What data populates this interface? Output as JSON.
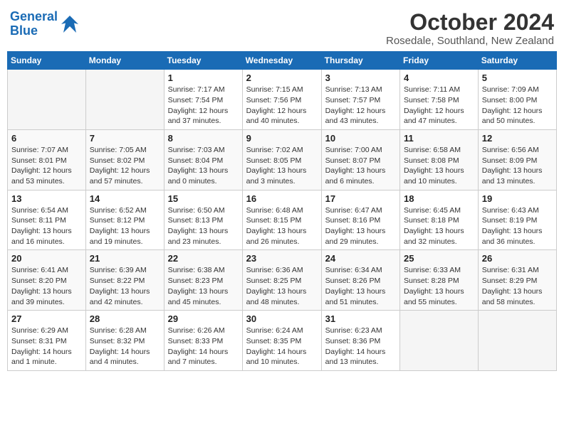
{
  "header": {
    "logo_line1": "General",
    "logo_line2": "Blue",
    "month": "October 2024",
    "location": "Rosedale, Southland, New Zealand"
  },
  "days_of_week": [
    "Sunday",
    "Monday",
    "Tuesday",
    "Wednesday",
    "Thursday",
    "Friday",
    "Saturday"
  ],
  "weeks": [
    [
      {
        "day": "",
        "content": ""
      },
      {
        "day": "",
        "content": ""
      },
      {
        "day": "1",
        "content": "Sunrise: 7:17 AM\nSunset: 7:54 PM\nDaylight: 12 hours and 37 minutes."
      },
      {
        "day": "2",
        "content": "Sunrise: 7:15 AM\nSunset: 7:56 PM\nDaylight: 12 hours and 40 minutes."
      },
      {
        "day": "3",
        "content": "Sunrise: 7:13 AM\nSunset: 7:57 PM\nDaylight: 12 hours and 43 minutes."
      },
      {
        "day": "4",
        "content": "Sunrise: 7:11 AM\nSunset: 7:58 PM\nDaylight: 12 hours and 47 minutes."
      },
      {
        "day": "5",
        "content": "Sunrise: 7:09 AM\nSunset: 8:00 PM\nDaylight: 12 hours and 50 minutes."
      }
    ],
    [
      {
        "day": "6",
        "content": "Sunrise: 7:07 AM\nSunset: 8:01 PM\nDaylight: 12 hours and 53 minutes."
      },
      {
        "day": "7",
        "content": "Sunrise: 7:05 AM\nSunset: 8:02 PM\nDaylight: 12 hours and 57 minutes."
      },
      {
        "day": "8",
        "content": "Sunrise: 7:03 AM\nSunset: 8:04 PM\nDaylight: 13 hours and 0 minutes."
      },
      {
        "day": "9",
        "content": "Sunrise: 7:02 AM\nSunset: 8:05 PM\nDaylight: 13 hours and 3 minutes."
      },
      {
        "day": "10",
        "content": "Sunrise: 7:00 AM\nSunset: 8:07 PM\nDaylight: 13 hours and 6 minutes."
      },
      {
        "day": "11",
        "content": "Sunrise: 6:58 AM\nSunset: 8:08 PM\nDaylight: 13 hours and 10 minutes."
      },
      {
        "day": "12",
        "content": "Sunrise: 6:56 AM\nSunset: 8:09 PM\nDaylight: 13 hours and 13 minutes."
      }
    ],
    [
      {
        "day": "13",
        "content": "Sunrise: 6:54 AM\nSunset: 8:11 PM\nDaylight: 13 hours and 16 minutes."
      },
      {
        "day": "14",
        "content": "Sunrise: 6:52 AM\nSunset: 8:12 PM\nDaylight: 13 hours and 19 minutes."
      },
      {
        "day": "15",
        "content": "Sunrise: 6:50 AM\nSunset: 8:13 PM\nDaylight: 13 hours and 23 minutes."
      },
      {
        "day": "16",
        "content": "Sunrise: 6:48 AM\nSunset: 8:15 PM\nDaylight: 13 hours and 26 minutes."
      },
      {
        "day": "17",
        "content": "Sunrise: 6:47 AM\nSunset: 8:16 PM\nDaylight: 13 hours and 29 minutes."
      },
      {
        "day": "18",
        "content": "Sunrise: 6:45 AM\nSunset: 8:18 PM\nDaylight: 13 hours and 32 minutes."
      },
      {
        "day": "19",
        "content": "Sunrise: 6:43 AM\nSunset: 8:19 PM\nDaylight: 13 hours and 36 minutes."
      }
    ],
    [
      {
        "day": "20",
        "content": "Sunrise: 6:41 AM\nSunset: 8:20 PM\nDaylight: 13 hours and 39 minutes."
      },
      {
        "day": "21",
        "content": "Sunrise: 6:39 AM\nSunset: 8:22 PM\nDaylight: 13 hours and 42 minutes."
      },
      {
        "day": "22",
        "content": "Sunrise: 6:38 AM\nSunset: 8:23 PM\nDaylight: 13 hours and 45 minutes."
      },
      {
        "day": "23",
        "content": "Sunrise: 6:36 AM\nSunset: 8:25 PM\nDaylight: 13 hours and 48 minutes."
      },
      {
        "day": "24",
        "content": "Sunrise: 6:34 AM\nSunset: 8:26 PM\nDaylight: 13 hours and 51 minutes."
      },
      {
        "day": "25",
        "content": "Sunrise: 6:33 AM\nSunset: 8:28 PM\nDaylight: 13 hours and 55 minutes."
      },
      {
        "day": "26",
        "content": "Sunrise: 6:31 AM\nSunset: 8:29 PM\nDaylight: 13 hours and 58 minutes."
      }
    ],
    [
      {
        "day": "27",
        "content": "Sunrise: 6:29 AM\nSunset: 8:31 PM\nDaylight: 14 hours and 1 minute."
      },
      {
        "day": "28",
        "content": "Sunrise: 6:28 AM\nSunset: 8:32 PM\nDaylight: 14 hours and 4 minutes."
      },
      {
        "day": "29",
        "content": "Sunrise: 6:26 AM\nSunset: 8:33 PM\nDaylight: 14 hours and 7 minutes."
      },
      {
        "day": "30",
        "content": "Sunrise: 6:24 AM\nSunset: 8:35 PM\nDaylight: 14 hours and 10 minutes."
      },
      {
        "day": "31",
        "content": "Sunrise: 6:23 AM\nSunset: 8:36 PM\nDaylight: 14 hours and 13 minutes."
      },
      {
        "day": "",
        "content": ""
      },
      {
        "day": "",
        "content": ""
      }
    ]
  ]
}
